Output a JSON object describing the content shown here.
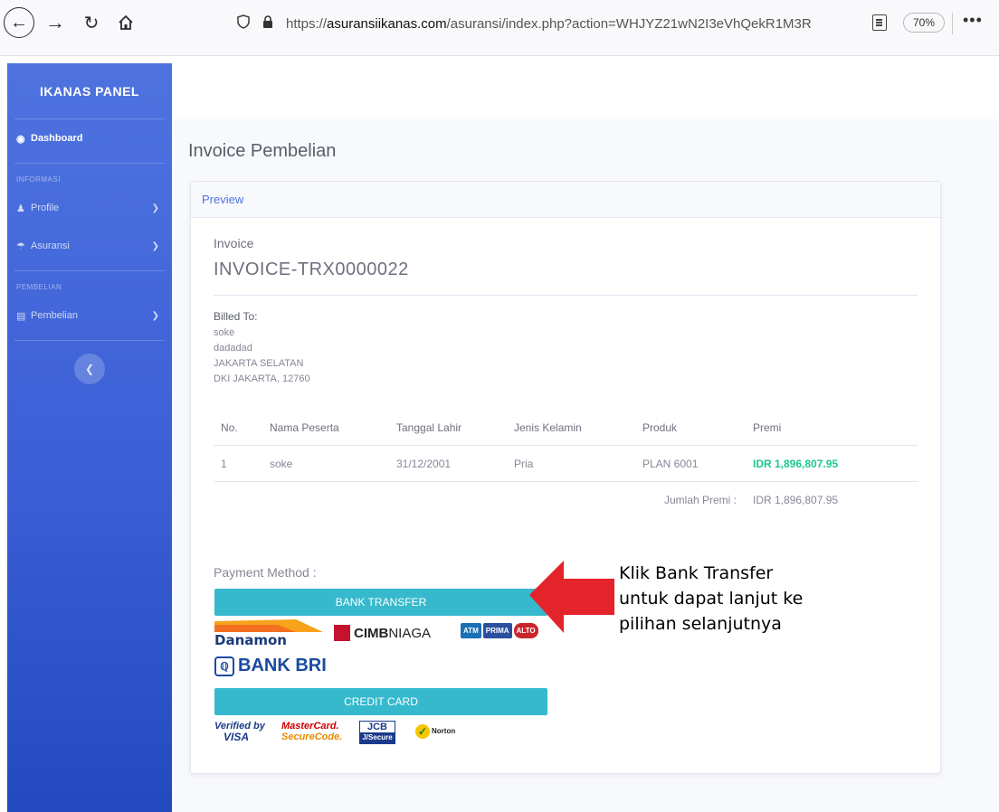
{
  "browser": {
    "url_prefix": "https://",
    "url_domain": "asuransiikanas.com",
    "url_path": "/asuransi/index.php?action=WHJYZ21wN2I3eVhQekR1M3R",
    "zoom": "70%"
  },
  "sidebar": {
    "brand": "IKANAS PANEL",
    "dashboard": "Dashboard",
    "section_informasi": "INFORMASI",
    "profile": "Profile",
    "asuransi": "Asuransi",
    "section_pembelian": "PEMBELIAN",
    "pembelian": "Pembelian"
  },
  "page": {
    "title": "Invoice Pembelian",
    "card_header": "Preview"
  },
  "invoice": {
    "label": "Invoice",
    "number": "INVOICE-TRX0000022",
    "billed_to_label": "Billed To:",
    "billed_to": [
      "soke",
      "dadadad",
      "JAKARTA SELATAN",
      "DKI JAKARTA, 12760"
    ]
  },
  "table": {
    "headers": [
      "No.",
      "Nama Peserta",
      "Tanggal Lahir",
      "Jenis Kelamin",
      "Produk",
      "Premi"
    ],
    "rows": [
      [
        "1",
        "soke",
        "31/12/2001",
        "Pria",
        "PLAN 6001",
        "IDR 1,896,807.95"
      ]
    ],
    "total_label": "Jumlah Premi :",
    "total_value": "IDR 1,896,807.95"
  },
  "payment": {
    "label": "Payment Method :",
    "bank_transfer": "BANK TRANSFER",
    "credit_card": "CREDIT CARD",
    "bank_logos": {
      "danamon": "Danamon",
      "cimb": "CIMB",
      "niaga": "NIAGA",
      "atm": [
        "ATM",
        "PRIMA",
        "ALTO"
      ],
      "bri": "BANK BRI"
    },
    "card_logos": {
      "visa_top": "Verified by",
      "visa_bottom": "VISA",
      "mc_top": "MasterCard.",
      "mc_bottom": "SecureCode.",
      "jcb_top": "JCB",
      "jcb_bottom": "J/Secure",
      "norton": "Norton"
    }
  },
  "annotation": {
    "lines": [
      "Klik Bank Transfer",
      "untuk dapat lanjut ke",
      "pilihan selanjutnya"
    ]
  },
  "colors": {
    "sidebar": "#4e73df",
    "button": "#36b9cc",
    "premi": "#1cc88a",
    "arrow": "#e3242b"
  }
}
